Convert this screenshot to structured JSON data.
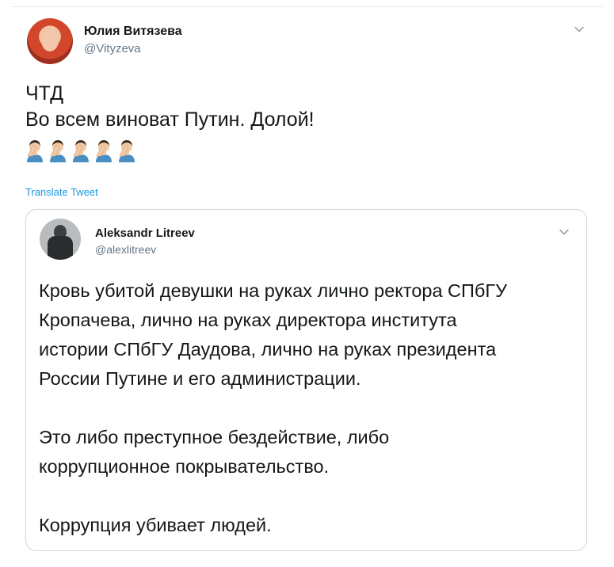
{
  "tweet": {
    "author_name": "Юлия Витязева",
    "author_handle": "@Vityzeva",
    "text_lines": [
      "ЧТД",
      "Во всем виноват Путин. Долой!"
    ],
    "emoji": [
      "facepalm-icon",
      "facepalm-icon",
      "facepalm-icon",
      "facepalm-icon",
      "facepalm-icon"
    ],
    "translate_label": "Translate Tweet"
  },
  "quoted_tweet": {
    "author_name": "Aleksandr Litreev",
    "author_handle": "@alexlitreev",
    "paragraphs": [
      [
        "Кровь убитой девушки на руках лично ректора СПбГУ",
        "Кропачева, лично на руках директора института",
        "истории СПбГУ Даудова, лично на руках президента",
        "России Путине и его администрации."
      ],
      [
        "Это либо преступное бездействие, либо",
        "коррупционное покрывательство."
      ],
      [
        "Коррупция убивает людей."
      ]
    ]
  },
  "colors": {
    "link": "#1b95e0",
    "secondary_text": "#657786",
    "border": "#ccd6dd"
  }
}
